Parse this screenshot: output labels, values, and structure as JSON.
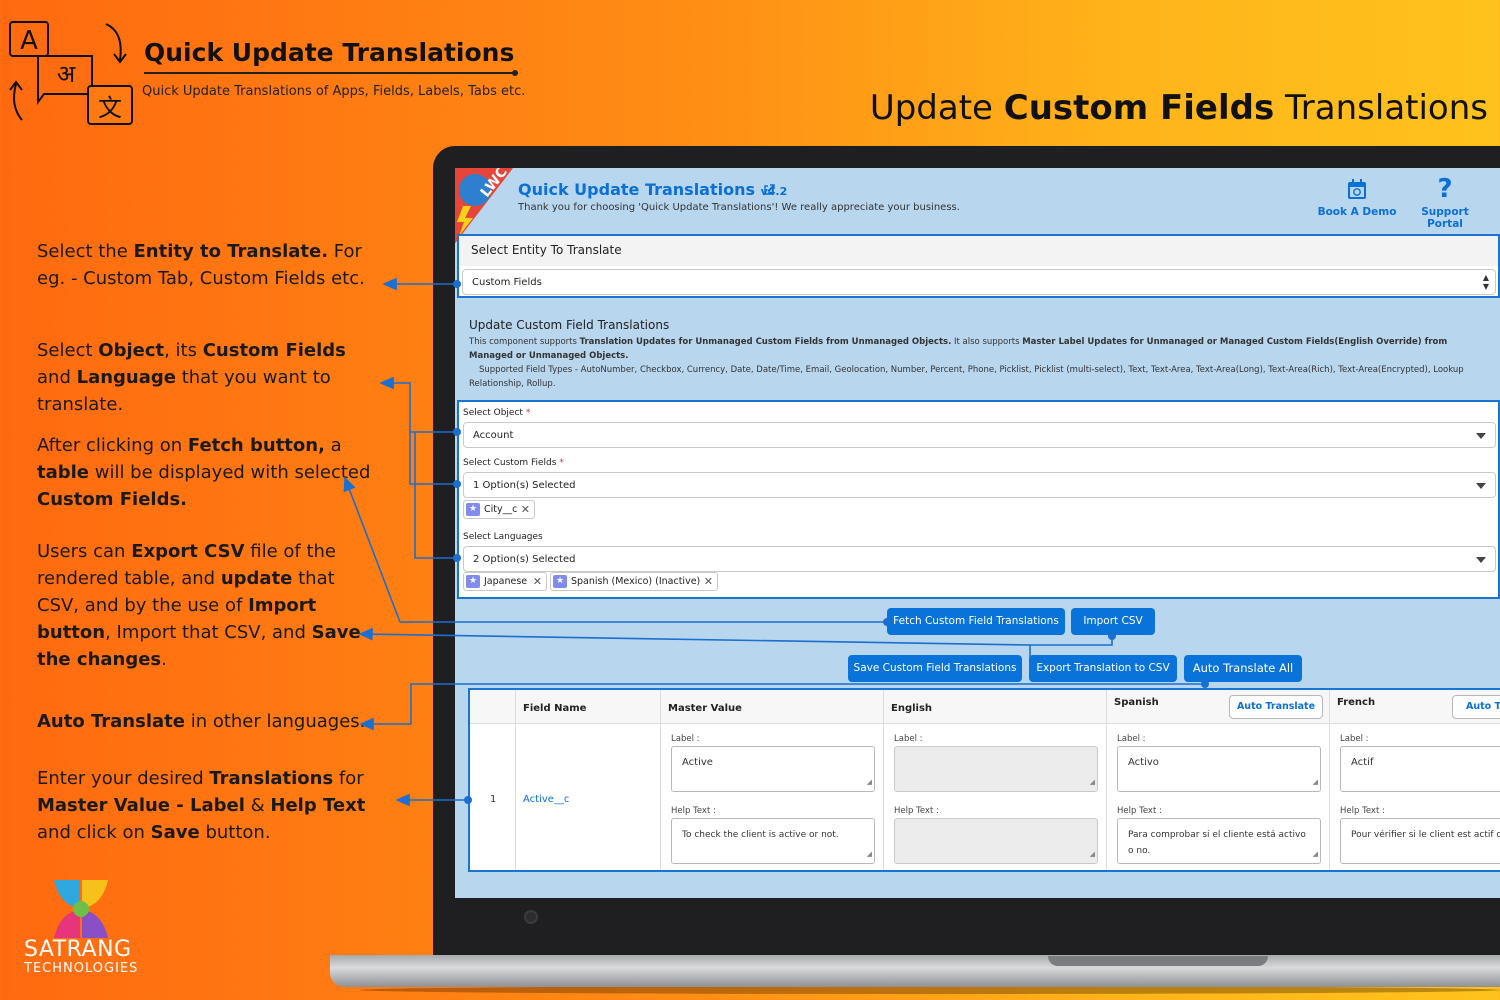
{
  "brand": {
    "title": "Quick Update Translations",
    "subtitle": "Quick Update Translations of Apps, Fields, Labels, Tabs etc.",
    "logo_glyphs": {
      "a": "A",
      "hindi": "अ",
      "chinese": "文"
    }
  },
  "headline": {
    "prefix": "Update ",
    "emphasis": "Custom Fields",
    "suffix": " Translations"
  },
  "descriptions": [
    {
      "parts": [
        [
          "Select the ",
          false
        ],
        [
          "Entity to Translate.",
          true
        ],
        [
          " For eg. - Custom Tab, Custom Fields etc.",
          false
        ]
      ]
    },
    {
      "parts": [
        [
          "Select ",
          false
        ],
        [
          "Object",
          true
        ],
        [
          ", its ",
          false
        ],
        [
          "Custom Fields",
          true
        ],
        [
          " and ",
          false
        ],
        [
          "Language",
          true
        ],
        [
          " that you want to translate.",
          false
        ]
      ]
    },
    {
      "parts": [
        [
          "After clicking on ",
          false
        ],
        [
          "Fetch button,",
          true
        ],
        [
          " a ",
          false
        ],
        [
          "table",
          true
        ],
        [
          " will be displayed with selected ",
          false
        ],
        [
          "Custom Fields.",
          true
        ]
      ]
    },
    {
      "parts": [
        [
          "Users can ",
          false
        ],
        [
          "Export CSV",
          true
        ],
        [
          " file of the rendered table, and ",
          false
        ],
        [
          "update",
          true
        ],
        [
          " that CSV, and by the use of ",
          false
        ],
        [
          "Import button",
          true
        ],
        [
          ", Import that CSV, and ",
          false
        ],
        [
          "Save the changes",
          true
        ],
        [
          ".",
          false
        ]
      ]
    },
    {
      "parts": [
        [
          "Auto Translate",
          true
        ],
        [
          " in other languages.",
          false
        ]
      ]
    },
    {
      "parts": [
        [
          "Enter your desired ",
          false
        ],
        [
          "Translations",
          true
        ],
        [
          " for ",
          false
        ],
        [
          "Master Value - Label",
          true
        ],
        [
          " & ",
          false
        ],
        [
          "Help Text",
          true
        ],
        [
          " and click on ",
          false
        ],
        [
          "Save",
          true
        ],
        [
          " button.",
          false
        ]
      ]
    }
  ],
  "company": {
    "name": "SATRANG",
    "sub": "TECHNOLOGIES"
  },
  "app": {
    "badge": "LWC",
    "title": "Quick Update Translations",
    "version": "v4.2",
    "thanks": "Thank you for choosing 'Quick Update Translations'! We really appreciate your business.",
    "book_demo": "Book A Demo",
    "support_portal": "Support Portal",
    "book_icon": "calendar-icon",
    "support_icon": "question-icon"
  },
  "entity": {
    "title": "Select Entity To Translate",
    "value": "Custom Fields"
  },
  "info": {
    "title": "Update Custom Field Translations",
    "line1_a": "This component supports ",
    "line1_b": "Translation Updates for Unmanaged Custom Fields from Unmanaged Objects.",
    "line1_c": " It also supports ",
    "line1_d": "Master Label Updates for Unmanaged or Managed Custom Fields(English Override) from Managed or Unmanaged Objects.",
    "line2": "Supported Field Types - AutoNumber, Checkbox, Currency, Date, Date/Time, Email, Geolocation, Number, Percent, Phone, Picklist, Picklist (multi-select), Text, Text-Area, Text-Area(Long), Text-Area(Rich), Text-Area(Encrypted), Lookup Relationship, Rollup."
  },
  "form": {
    "object_label": "Select Object",
    "object_value": "Account",
    "fields_label": "Select Custom Fields",
    "fields_value": "1 Option(s) Selected",
    "field_pills": [
      "City__c"
    ],
    "languages_label": "Select Languages",
    "languages_value": "2 Option(s) Selected",
    "language_pills": [
      "Japanese",
      "Spanish (Mexico) (Inactive)"
    ],
    "required_mark": "*"
  },
  "buttons": {
    "fetch": "Fetch Custom Field Translations",
    "import": "Import CSV",
    "save": "Save Custom Field Translations",
    "export": "Export Translation to CSV",
    "auto_all": "Auto Translate All"
  },
  "table": {
    "headers": {
      "field_name": "Field Name",
      "master_value": "Master Value",
      "english": "English",
      "spanish": "Spanish",
      "french": "French"
    },
    "auto_translate": "Auto Translate",
    "auto_translate_cut": "Auto Tr",
    "label_caption": "Label :",
    "help_caption": "Help Text :",
    "row": {
      "index": "1",
      "field": "Active__c",
      "master_label": "Active",
      "master_help": "To check the client is active or not.",
      "english_label": "",
      "english_help": "",
      "spanish_label": "Activo",
      "spanish_help": "Para comprobar si el cliente está activo o no.",
      "french_label": "Actif",
      "french_help": "Pour vérifier si le client est actif ou non."
    }
  },
  "colors": {
    "accent": "#0a73d9",
    "panel_border": "#1a74d0",
    "screen_bg": "#b9d6ef"
  }
}
